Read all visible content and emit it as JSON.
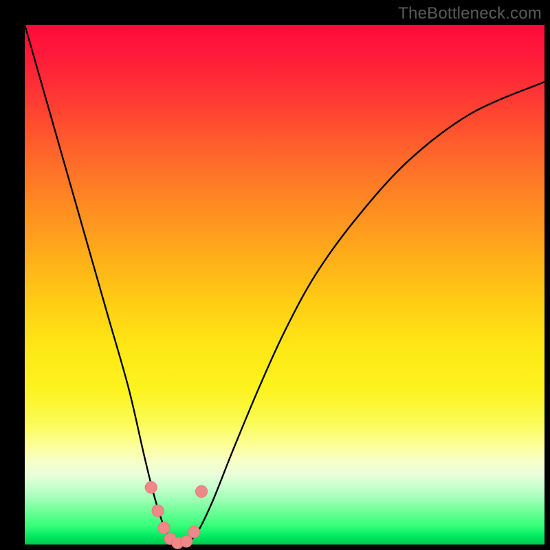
{
  "watermark": "TheBottleneck.com",
  "colors": {
    "curve": "#000000",
    "marker_fill": "#ef8989",
    "marker_stroke": "#e97676",
    "gradient_top": "#ff0a3a",
    "gradient_bottom": "#00c94f",
    "background": "#000000"
  },
  "chart_data": {
    "type": "line",
    "title": "",
    "xlabel": "",
    "ylabel": "",
    "xlim": [
      0,
      100
    ],
    "ylim": [
      0,
      100
    ],
    "grid": false,
    "legend": false,
    "note": "Values estimated from pixel positions; y is bottleneck % (0 at bottom, 100 at top).",
    "series": [
      {
        "name": "bottleneck-curve",
        "x": [
          0,
          4,
          8,
          12,
          16,
          20,
          23,
          25,
          27,
          29,
          30,
          31,
          33,
          36,
          40,
          45,
          50,
          56,
          64,
          74,
          86,
          100
        ],
        "y": [
          100,
          86,
          72,
          58,
          44,
          30,
          17,
          9,
          3,
          0.4,
          0,
          0.4,
          2,
          8,
          18,
          30,
          41,
          52,
          63,
          74,
          83,
          89
        ]
      }
    ],
    "markers": {
      "name": "valley-dots",
      "x": [
        24.3,
        25.6,
        26.8,
        28.0,
        29.4,
        31.1,
        32.6,
        34.0
      ],
      "y": [
        11.0,
        6.5,
        3.2,
        1.1,
        0.3,
        0.6,
        2.4,
        10.2
      ]
    }
  }
}
